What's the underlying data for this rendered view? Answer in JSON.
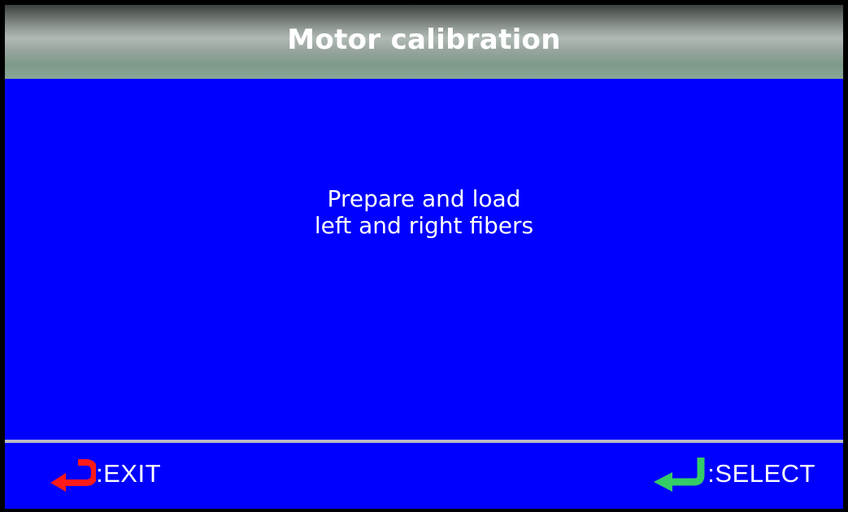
{
  "title": "Motor calibration",
  "message": {
    "line1": "Prepare and load",
    "line2": "left and right fibers"
  },
  "footer": {
    "exit_label": ":EXIT",
    "select_label": ":SELECT"
  },
  "icons": {
    "exit": "return-arrow-icon",
    "select": "enter-arrow-icon"
  },
  "colors": {
    "screen_background": "#0000ff",
    "exit_icon": "#ff1a1a",
    "select_icon": "#33cc66"
  }
}
